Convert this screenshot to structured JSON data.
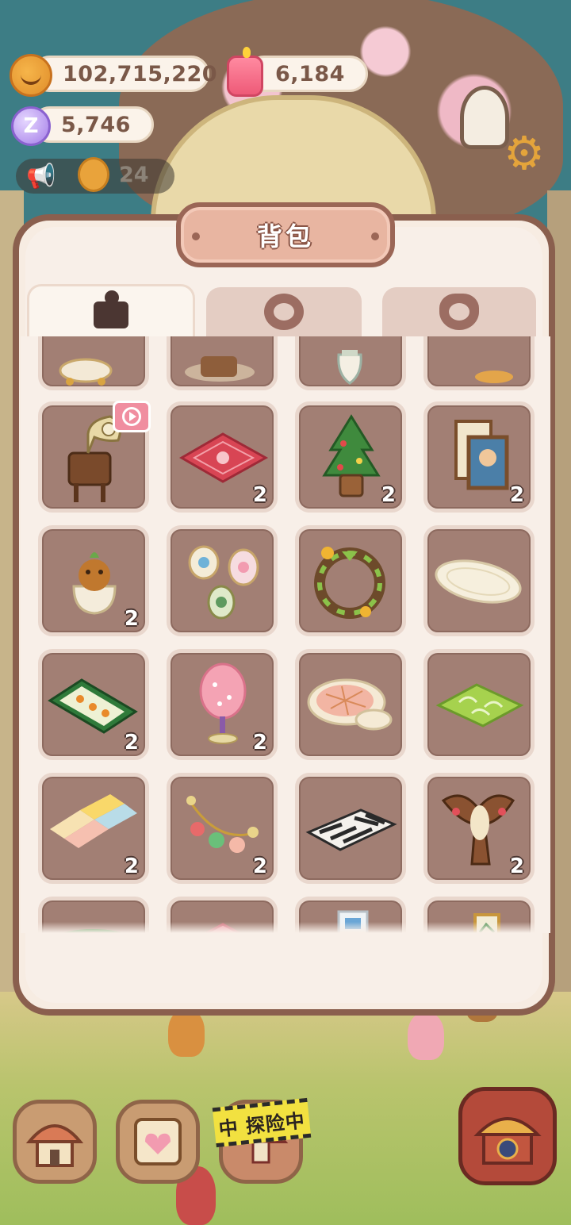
{
  "hud": {
    "cookies": "102,715,220",
    "candles": "6,184",
    "crystals": "5,746",
    "announcement_count": "24"
  },
  "icons": {
    "cookie": "cookie-icon",
    "candle": "candle-icon",
    "crystal": "crystal-candy-icon",
    "megaphone": "megaphone-icon",
    "settings": "gear-icon"
  },
  "panel": {
    "title": "背包",
    "tabs": [
      {
        "name": "items",
        "icon": "box-icon",
        "active": true
      },
      {
        "name": "cookies",
        "icon": "cookie-silhouette-icon",
        "active": false
      },
      {
        "name": "pets",
        "icon": "pet-silhouette-icon",
        "active": false
      }
    ]
  },
  "items": [
    {
      "id": "top-cut-1",
      "icon": "bathtub-icon",
      "qty": ""
    },
    {
      "id": "top-cut-2",
      "icon": "barrel-icon",
      "qty": ""
    },
    {
      "id": "top-cut-3",
      "icon": "vase-icon",
      "qty": ""
    },
    {
      "id": "top-cut-4",
      "icon": "cushion-icon",
      "qty": ""
    },
    {
      "id": "gramophone",
      "icon": "gramophone-icon",
      "qty": "",
      "video": true
    },
    {
      "id": "red-rug",
      "icon": "red-rug-icon",
      "qty": "2"
    },
    {
      "id": "xmas-tree",
      "icon": "christmas-tree-icon",
      "qty": "2"
    },
    {
      "id": "portrait",
      "icon": "portrait-frame-icon",
      "qty": "2"
    },
    {
      "id": "bear-pot",
      "icon": "bear-flowerpot-icon",
      "qty": "2"
    },
    {
      "id": "plates",
      "icon": "decor-plates-icon",
      "qty": ""
    },
    {
      "id": "wreath",
      "icon": "wreath-icon",
      "qty": ""
    },
    {
      "id": "oval-rug",
      "icon": "oval-rug-icon",
      "qty": ""
    },
    {
      "id": "carrot-rug",
      "icon": "carrot-rug-icon",
      "qty": "2"
    },
    {
      "id": "pink-tree",
      "icon": "pink-tree-lamp-icon",
      "qty": "2"
    },
    {
      "id": "plaid-rug",
      "icon": "plaid-rug-icon",
      "qty": ""
    },
    {
      "id": "leaf-rug",
      "icon": "leaf-rug-icon",
      "qty": ""
    },
    {
      "id": "puzzle-mat",
      "icon": "puzzle-mat-icon",
      "qty": "2"
    },
    {
      "id": "garland",
      "icon": "ornament-garland-icon",
      "qty": "2"
    },
    {
      "id": "zebra-rug",
      "icon": "zebra-rug-icon",
      "qty": ""
    },
    {
      "id": "kite",
      "icon": "bird-kite-icon",
      "qty": "2"
    },
    {
      "id": "bot-cut-1",
      "icon": "watermelon-icon",
      "qty": ""
    },
    {
      "id": "bot-cut-2",
      "icon": "pink-mat-icon",
      "qty": ""
    },
    {
      "id": "bot-cut-3",
      "icon": "picture-icon",
      "qty": ""
    },
    {
      "id": "bot-cut-4",
      "icon": "frame-icon",
      "qty": ""
    }
  ],
  "bottom_bar": {
    "explore_label": "中 探险中"
  },
  "colors": {
    "panel_border": "#8a5f4e",
    "cell_bg": "#a27f74",
    "title_plate": "#e8b5a1"
  }
}
